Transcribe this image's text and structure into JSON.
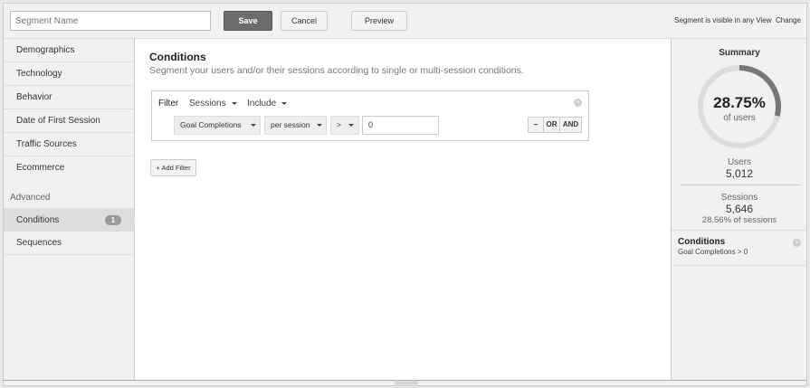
{
  "topbar": {
    "segment_name_placeholder": "Segment Name",
    "save": "Save",
    "cancel": "Cancel",
    "preview": "Preview",
    "visibility": "Segment is visible in any View",
    "change": "Change"
  },
  "sidebar": {
    "items": [
      "Demographics",
      "Technology",
      "Behavior",
      "Date of First Session",
      "Traffic Sources",
      "Ecommerce"
    ],
    "advanced_label": "Advanced",
    "advanced_items": [
      {
        "label": "Conditions",
        "badge": "1"
      },
      {
        "label": "Sequences"
      }
    ]
  },
  "main": {
    "title": "Conditions",
    "subtitle": "Segment your users and/or their sessions according to single or multi-session conditions.",
    "filter": {
      "label": "Filter",
      "scope": "Sessions",
      "mode": "Include",
      "dimension": "Goal Completions",
      "per": "per session",
      "operator": ">",
      "value": "0",
      "minus": "–",
      "or": "OR",
      "and": "AND"
    },
    "add_filter": "+ Add Filter"
  },
  "summary": {
    "title": "Summary",
    "percent": "28.75%",
    "percent_value": 28.75,
    "of_users": "of users",
    "users_label": "Users",
    "users": "5,012",
    "sessions_label": "Sessions",
    "sessions": "5,646",
    "sessions_pct": "28.56% of sessions",
    "conditions_title": "Conditions",
    "conditions_text": "Goal Completions > 0"
  },
  "colors": {
    "donut_fill": "#777777",
    "donut_track": "#dddddd"
  }
}
